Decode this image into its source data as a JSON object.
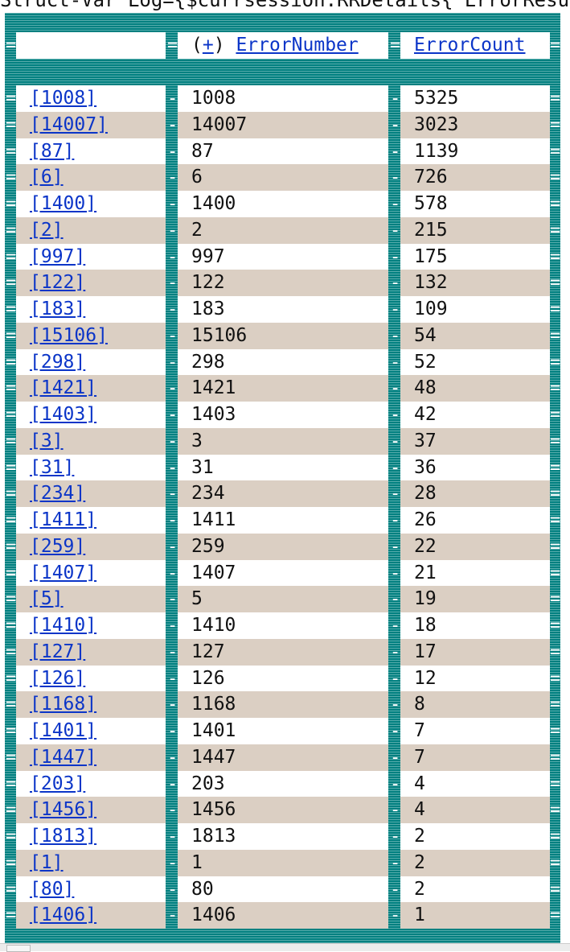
{
  "top_text": "Struct-Var Log={$currsession.RRDetails{\"ErrorResul",
  "header": {
    "sort_prefix": "(",
    "sort_toggle": "+",
    "sort_suffix": ")",
    "col_error_number": "ErrorNumber",
    "col_error_count": "ErrorCount"
  },
  "rows": [
    {
      "key": "[1008]",
      "error_number": "1008",
      "error_count": "5325"
    },
    {
      "key": "[14007]",
      "error_number": "14007",
      "error_count": "3023"
    },
    {
      "key": "[87]",
      "error_number": "87",
      "error_count": "1139"
    },
    {
      "key": "[6]",
      "error_number": "6",
      "error_count": "726"
    },
    {
      "key": "[1400]",
      "error_number": "1400",
      "error_count": "578"
    },
    {
      "key": "[2]",
      "error_number": "2",
      "error_count": "215"
    },
    {
      "key": "[997]",
      "error_number": "997",
      "error_count": "175"
    },
    {
      "key": "[122]",
      "error_number": "122",
      "error_count": "132"
    },
    {
      "key": "[183]",
      "error_number": "183",
      "error_count": "109"
    },
    {
      "key": "[15106]",
      "error_number": "15106",
      "error_count": "54"
    },
    {
      "key": "[298]",
      "error_number": "298",
      "error_count": "52"
    },
    {
      "key": "[1421]",
      "error_number": "1421",
      "error_count": "48"
    },
    {
      "key": "[1403]",
      "error_number": "1403",
      "error_count": "42"
    },
    {
      "key": "[3]",
      "error_number": "3",
      "error_count": "37"
    },
    {
      "key": "[31]",
      "error_number": "31",
      "error_count": "36"
    },
    {
      "key": "[234]",
      "error_number": "234",
      "error_count": "28"
    },
    {
      "key": "[1411]",
      "error_number": "1411",
      "error_count": "26"
    },
    {
      "key": "[259]",
      "error_number": "259",
      "error_count": "22"
    },
    {
      "key": "[1407]",
      "error_number": "1407",
      "error_count": "21"
    },
    {
      "key": "[5]",
      "error_number": "5",
      "error_count": "19"
    },
    {
      "key": "[1410]",
      "error_number": "1410",
      "error_count": "18"
    },
    {
      "key": "[127]",
      "error_number": "127",
      "error_count": "17"
    },
    {
      "key": "[126]",
      "error_number": "126",
      "error_count": "12"
    },
    {
      "key": "[1168]",
      "error_number": "1168",
      "error_count": "8"
    },
    {
      "key": "[1401]",
      "error_number": "1401",
      "error_count": "7"
    },
    {
      "key": "[1447]",
      "error_number": "1447",
      "error_count": "7"
    },
    {
      "key": "[203]",
      "error_number": "203",
      "error_count": "4"
    },
    {
      "key": "[1456]",
      "error_number": "1456",
      "error_count": "4"
    },
    {
      "key": "[1813]",
      "error_number": "1813",
      "error_count": "2"
    },
    {
      "key": "[1]",
      "error_number": "1",
      "error_count": "2"
    },
    {
      "key": "[80]",
      "error_number": "80",
      "error_count": "2"
    },
    {
      "key": "[1406]",
      "error_number": "1406",
      "error_count": "1"
    }
  ],
  "colors": {
    "frame": "#008080",
    "row_alt": "#dbcfc3",
    "row_base": "#ffffff",
    "link": "#0b35c8"
  }
}
